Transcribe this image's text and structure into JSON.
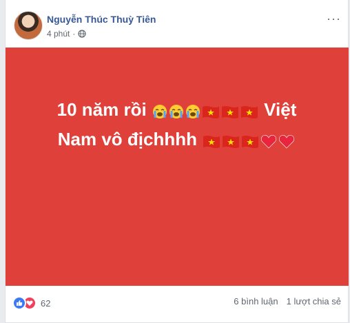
{
  "post": {
    "author": "Nguyễn Thúc Thuỳ Tiên",
    "time": "4 phút",
    "privacy_icon": "globe-icon",
    "background_color": "#e0403a",
    "text_line_1": "10 năm rồi",
    "text_line_1_end": "Việt",
    "text_line_2": "Nam vô địchhhh",
    "emojis_line_1": [
      "loudly-crying-face",
      "loudly-crying-face",
      "loudly-crying-face",
      "vietnam-flag",
      "vietnam-flag",
      "vietnam-flag"
    ],
    "emojis_line_2": [
      "vietnam-flag",
      "vietnam-flag",
      "vietnam-flag",
      "red-heart",
      "red-heart"
    ]
  },
  "footer": {
    "reaction_icons": [
      "like-icon",
      "love-icon"
    ],
    "reaction_count": "62",
    "comments": "6 bình luận",
    "shares": "1 lượt chia sẻ"
  },
  "colors": {
    "author_link": "#365899",
    "like": "#3b7af2",
    "love": "#f0405b"
  }
}
